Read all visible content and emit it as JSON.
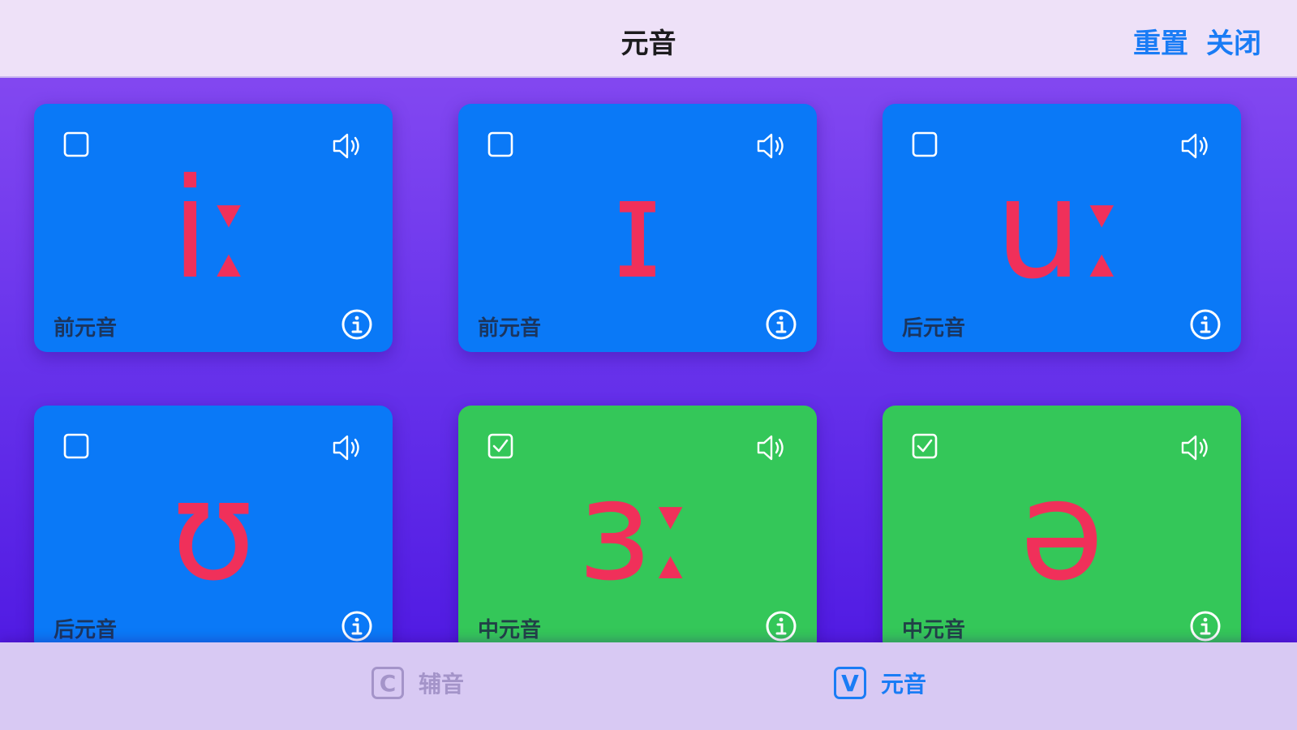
{
  "header": {
    "title": "元音",
    "reset_label": "重置",
    "close_label": "关闭"
  },
  "cards": [
    {
      "symbol": "iː",
      "category": "前元音",
      "checked": false,
      "color": "blue"
    },
    {
      "symbol": "ɪ",
      "category": "前元音",
      "checked": false,
      "color": "blue"
    },
    {
      "symbol": "uː",
      "category": "后元音",
      "checked": false,
      "color": "blue"
    },
    {
      "symbol": "ʊ",
      "category": "后元音",
      "checked": false,
      "color": "blue"
    },
    {
      "symbol": "ɜː",
      "category": "中元音",
      "checked": true,
      "color": "green"
    },
    {
      "symbol": "ə",
      "category": "中元音",
      "checked": true,
      "color": "green"
    }
  ],
  "tabs": [
    {
      "badge": "C",
      "label": "辅音",
      "active": false
    },
    {
      "badge": "V",
      "label": "元音",
      "active": true
    }
  ],
  "colors": {
    "unchecked_card": "#0a79f7",
    "checked_card": "#34c759",
    "symbol": "#f0305a",
    "accent": "#1a7cf5"
  },
  "icons": {
    "checkbox": "checkbox-icon",
    "speaker": "speaker-icon",
    "info": "info-icon"
  }
}
